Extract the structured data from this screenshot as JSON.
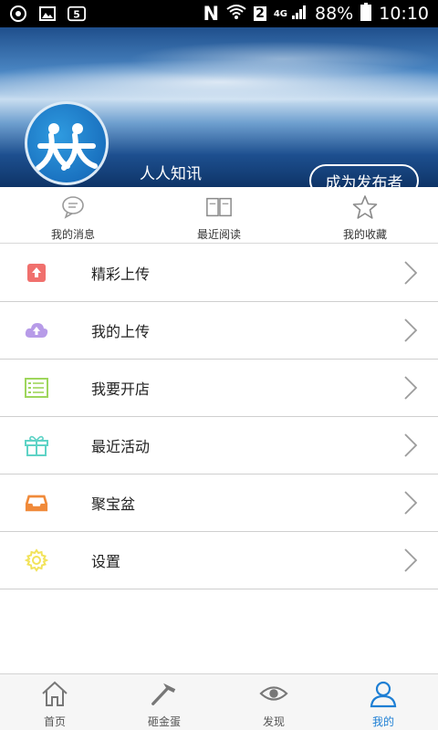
{
  "status_bar": {
    "battery_percent": "88%",
    "time": "10:10",
    "network_type": "4G",
    "sim_slot": "2",
    "n_label": "N",
    "icons": [
      "sync-icon",
      "image-icon",
      "app-5-icon",
      "nfc-icon",
      "wifi-icon",
      "signal-icon",
      "battery-icon"
    ]
  },
  "profile": {
    "username": "人人知讯",
    "become_publisher_label": "成为发布者"
  },
  "quick_actions": [
    {
      "label": "我的消息",
      "icon": "message-icon"
    },
    {
      "label": "最近阅读",
      "icon": "book-icon"
    },
    {
      "label": "我的收藏",
      "icon": "star-icon"
    }
  ],
  "menu": [
    {
      "label": "精彩上传",
      "icon": "upload-box-icon",
      "color": "#f0706d"
    },
    {
      "label": "我的上传",
      "icon": "cloud-upload-icon",
      "color": "#b79be8"
    },
    {
      "label": "我要开店",
      "icon": "shop-list-icon",
      "color": "#9ed65c"
    },
    {
      "label": "最近活动",
      "icon": "gift-icon",
      "color": "#5fd3c6"
    },
    {
      "label": "聚宝盆",
      "icon": "tray-icon",
      "color": "#f08a3a"
    },
    {
      "label": "设置",
      "icon": "gear-icon",
      "color": "#f2e35a"
    }
  ],
  "bottom_nav": [
    {
      "label": "首页",
      "icon": "home-icon",
      "active": false
    },
    {
      "label": "砸金蛋",
      "icon": "hammer-icon",
      "active": false
    },
    {
      "label": "发现",
      "icon": "eye-icon",
      "active": false
    },
    {
      "label": "我的",
      "icon": "user-icon",
      "active": true
    }
  ],
  "colors": {
    "accent": "#1e7fd4",
    "header_blue": "#1a5fa8"
  }
}
